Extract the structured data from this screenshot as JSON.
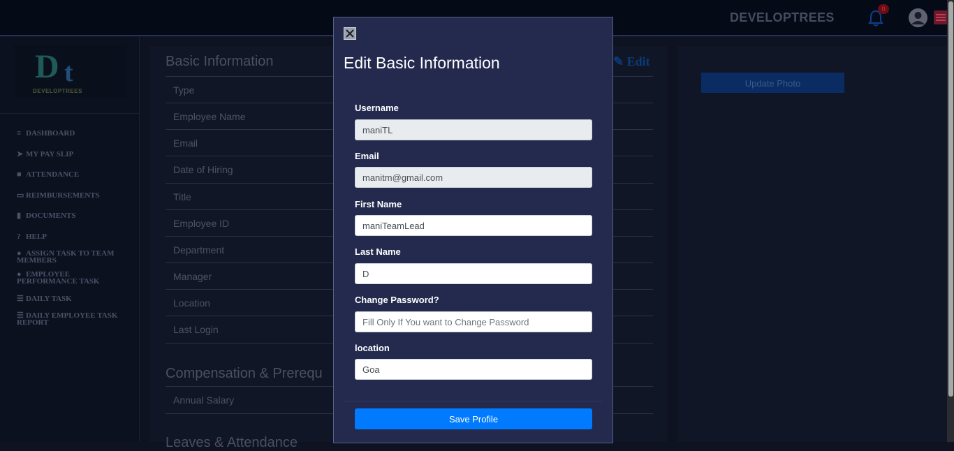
{
  "header": {
    "brand": "DEVELOPTREES",
    "notification_count": "0"
  },
  "sidebar": {
    "logo_text": "DEVELOPTREES",
    "items": [
      {
        "label": "DASHBOARD",
        "icon": "bars-icon"
      },
      {
        "label": "MY PAY SLIP",
        "icon": "paper-plane-icon"
      },
      {
        "label": "ATTENDANCE",
        "icon": "briefcase-icon"
      },
      {
        "label": "REIMBURSEMENTS",
        "icon": "credit-card-icon"
      },
      {
        "label": "DOCUMENTS",
        "icon": "file-icon"
      },
      {
        "label": "HELP",
        "icon": "question-circle-icon"
      },
      {
        "label": "ASSIGN TASK TO TEAM MEMBERS",
        "icon": "users-icon"
      },
      {
        "label": "EMPLOYEE PERFORMANCE TASK",
        "icon": "user-edit-icon"
      },
      {
        "label": "DAILY TASK",
        "icon": "list-icon"
      },
      {
        "label": "DAILY EMPLOYEE TASK REPORT",
        "icon": "list-icon"
      }
    ]
  },
  "main": {
    "basic_title": "Basic Information",
    "edit_label": "Edit",
    "rows": [
      "Type",
      "Employee Name",
      "Email",
      "Date of Hiring",
      "Title",
      "Employee ID",
      "Department",
      "Manager",
      "Location",
      "Last Login"
    ],
    "compensation_title": "Compensation & Prerequ",
    "compensation_rows": [
      "Annual Salary"
    ],
    "leaves_title": "Leaves & Attendance"
  },
  "right_panel": {
    "update_photo_label": "Update Photo"
  },
  "modal": {
    "title": "Edit Basic Information",
    "fields": {
      "username": {
        "label": "Username",
        "value": "maniTL"
      },
      "email": {
        "label": "Email",
        "value": "manitm@gmail.com"
      },
      "first_name": {
        "label": "First Name",
        "value": "maniTeamLead"
      },
      "last_name": {
        "label": "Last Name",
        "value": "D"
      },
      "change_password": {
        "label": "Change Password?",
        "placeholder": "Fill Only If You want to Change Password"
      },
      "location": {
        "label": "location",
        "value": "Goa"
      }
    },
    "save_label": "Save Profile"
  },
  "colors": {
    "accent": "#007bff",
    "modal_bg": "#232a4e",
    "topbar_bg": "#050a17"
  }
}
